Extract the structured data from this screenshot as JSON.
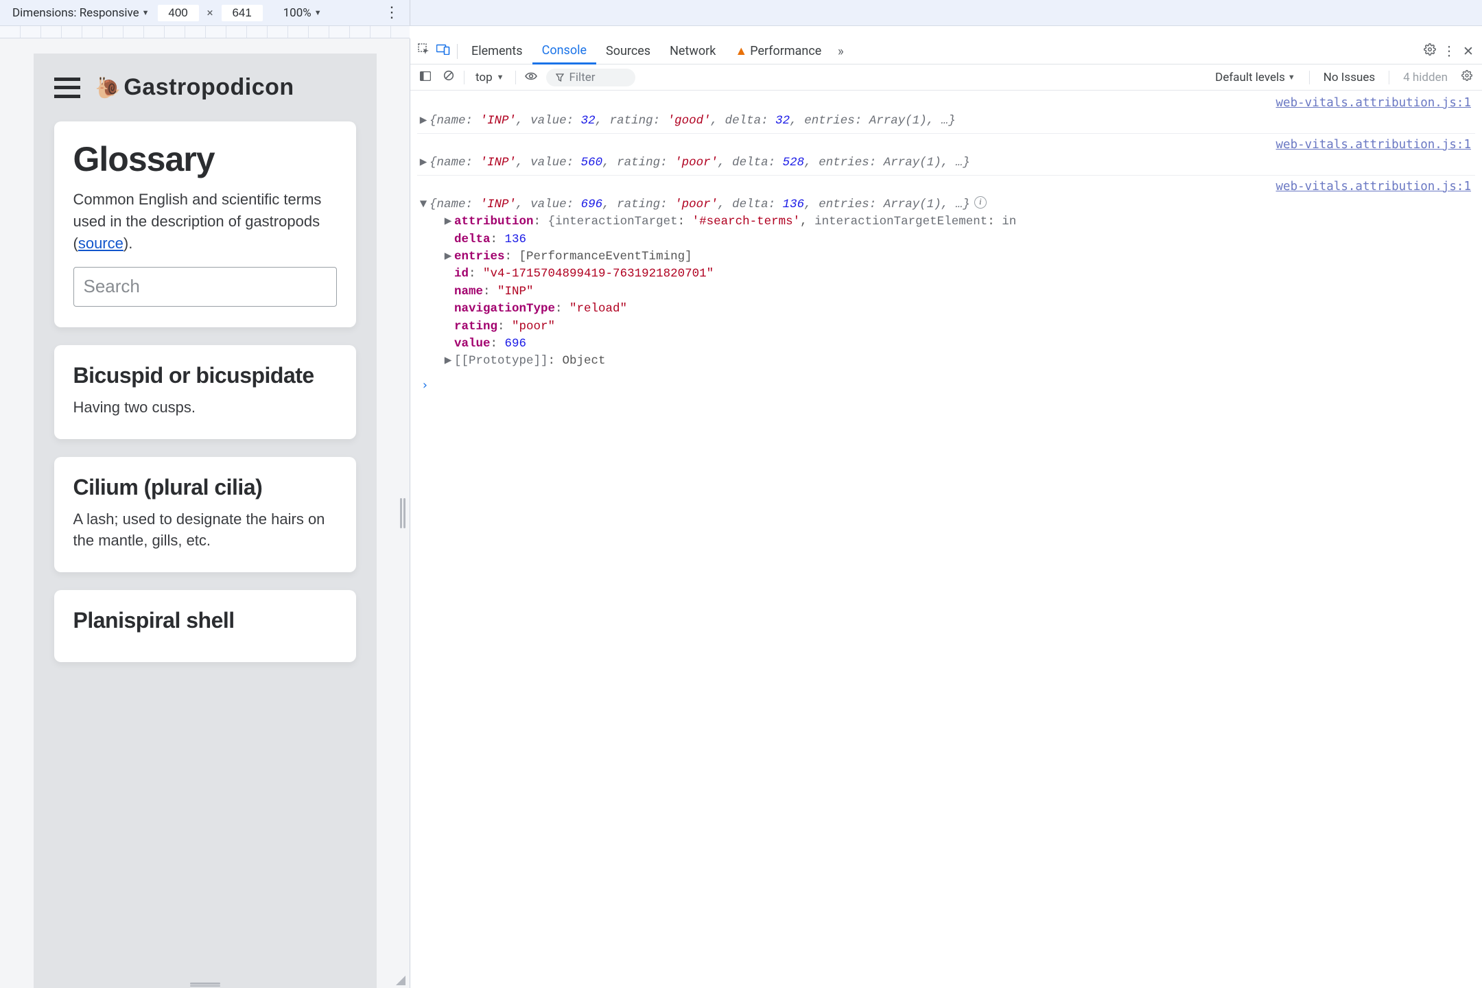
{
  "deviceToolbar": {
    "dimensionsLabel": "Dimensions: Responsive",
    "width": "400",
    "height": "641",
    "zoom": "100%"
  },
  "app": {
    "title": "Gastropodicon",
    "snail": "🐌",
    "glossary": {
      "heading": "Glossary",
      "desc_pre": "Common English and scientific terms used in the description of gastropods (",
      "source_label": "source",
      "desc_post": ").",
      "search_placeholder": "Search"
    },
    "entries": [
      {
        "term": "Bicuspid or bicuspidate",
        "def": "Having two cusps."
      },
      {
        "term": "Cilium (plural cilia)",
        "def": "A lash; used to designate the hairs on the mantle, gills, etc."
      },
      {
        "term": "Planispiral shell",
        "def": ""
      }
    ]
  },
  "devtools": {
    "tabs": {
      "elements": "Elements",
      "console": "Console",
      "sources": "Sources",
      "network": "Network",
      "performance": "Performance"
    },
    "toolbar": {
      "context": "top",
      "filter_placeholder": "Filter",
      "levels": "Default levels",
      "no_issues": "No Issues",
      "hidden": "4 hidden"
    },
    "source_link": "web-vitals.attribution.js:1",
    "logs": [
      {
        "summary_tokens": [
          "{",
          "name:",
          " 'INP'",
          ",",
          " value:",
          " 32",
          ",",
          " rating:",
          " 'good'",
          ",",
          " delta:",
          " 32",
          ",",
          " entries:",
          " Array(1)",
          ",",
          " …}"
        ]
      },
      {
        "summary_tokens": [
          "{",
          "name:",
          " 'INP'",
          ",",
          " value:",
          " 560",
          ",",
          " rating:",
          " 'poor'",
          ",",
          " delta:",
          " 528",
          ",",
          " entries:",
          " Array(1)",
          ",",
          " …}"
        ]
      },
      {
        "summary_tokens": [
          "{",
          "name:",
          " 'INP'",
          ",",
          " value:",
          " 696",
          ",",
          " rating:",
          " 'poor'",
          ",",
          " delta:",
          " 136",
          ",",
          " entries:",
          " Array(1)",
          ",",
          " …}"
        ],
        "expanded": {
          "attribution_summary": "{interactionTarget: '#search-terms', interactionTargetElement: in",
          "delta": "136",
          "entries": "[PerformanceEventTiming]",
          "id": "\"v4-1715704899419-7631921820701\"",
          "name": "\"INP\"",
          "navigationType": "\"reload\"",
          "rating": "\"poor\"",
          "value": "696",
          "prototype": "Object"
        }
      }
    ]
  }
}
